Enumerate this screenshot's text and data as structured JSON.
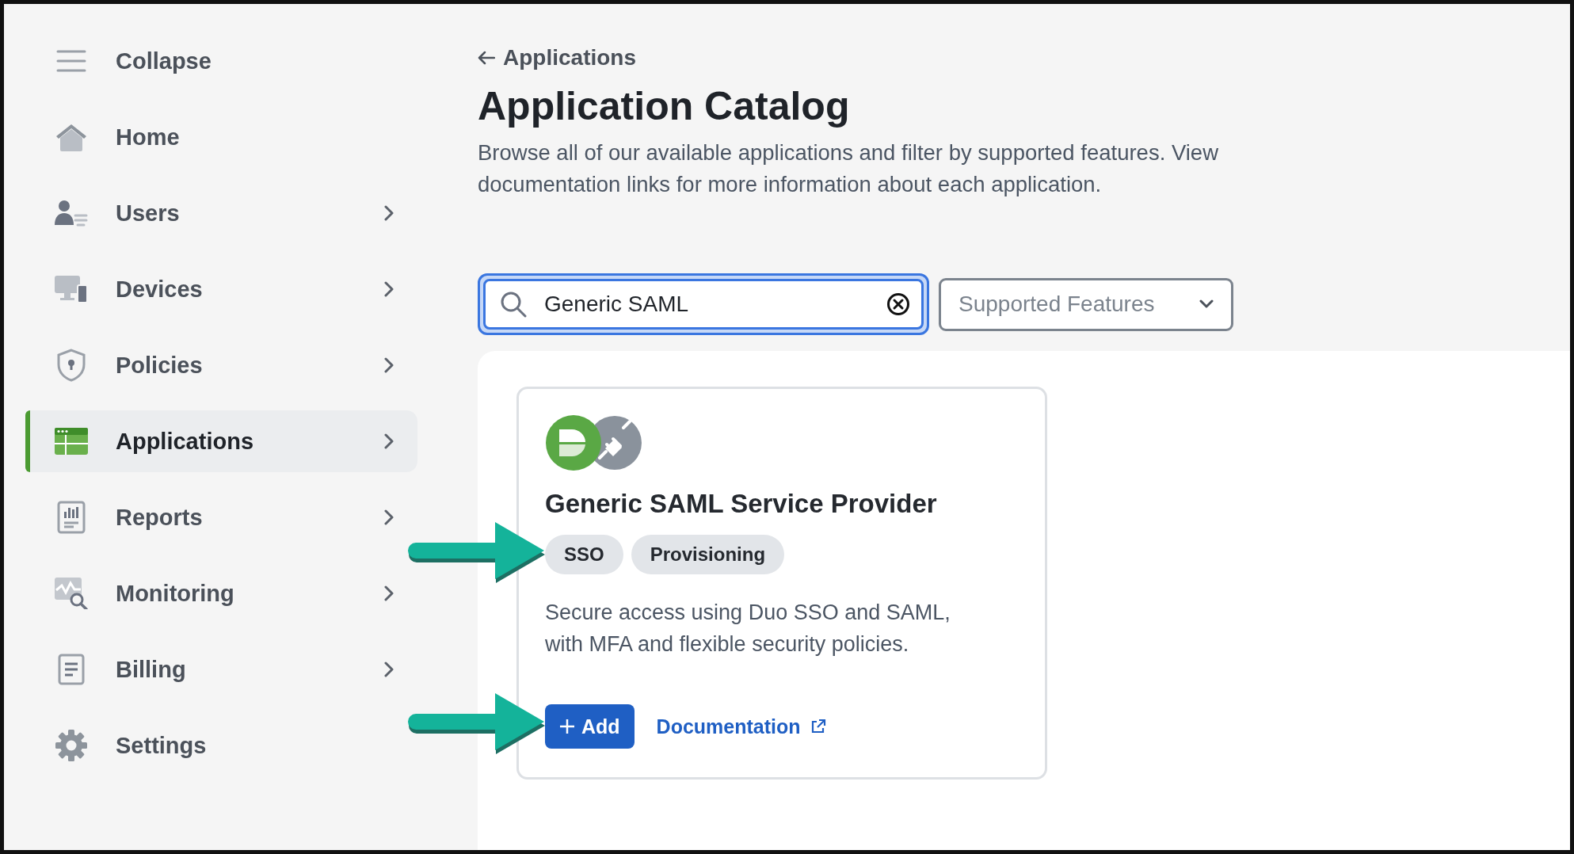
{
  "sidebar": {
    "items": [
      {
        "label": "Collapse",
        "has_submenu": false,
        "selected": false
      },
      {
        "label": "Home",
        "has_submenu": false,
        "selected": false
      },
      {
        "label": "Users",
        "has_submenu": true,
        "selected": false
      },
      {
        "label": "Devices",
        "has_submenu": true,
        "selected": false
      },
      {
        "label": "Policies",
        "has_submenu": true,
        "selected": false
      },
      {
        "label": "Applications",
        "has_submenu": true,
        "selected": true
      },
      {
        "label": "Reports",
        "has_submenu": true,
        "selected": false
      },
      {
        "label": "Monitoring",
        "has_submenu": true,
        "selected": false
      },
      {
        "label": "Billing",
        "has_submenu": true,
        "selected": false
      },
      {
        "label": "Settings",
        "has_submenu": false,
        "selected": false
      }
    ]
  },
  "header": {
    "back_link": "Applications",
    "title": "Application Catalog",
    "description": "Browse all of our available applications and filter by supported features. View documentation links for more information about each application."
  },
  "search": {
    "value": "Generic SAML",
    "focused": true
  },
  "features_filter": {
    "placeholder": "Supported Features"
  },
  "cards": [
    {
      "title": "Generic SAML Service Provider",
      "tags": [
        "SSO",
        "Provisioning"
      ],
      "description": "Secure access using Duo SSO and SAML, with MFA and flexible security policies.",
      "add_button": "Add",
      "documentation_link": "Documentation"
    }
  ]
}
